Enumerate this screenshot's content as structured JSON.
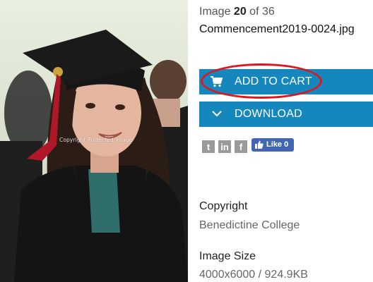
{
  "image_counter": {
    "prefix": "Image",
    "current": "20",
    "separator": "of",
    "total": "36"
  },
  "filename": "Commencement2019-0024.jpg",
  "photo": {
    "watermark": "Copyright Protected Image"
  },
  "buttons": {
    "add_to_cart": {
      "label": "ADD TO CART",
      "icon": "cart-icon"
    },
    "download": {
      "label": "DOWNLOAD",
      "icon": "chevron-down-icon"
    }
  },
  "social": {
    "twitter_glyph": "t",
    "linkedin_glyph": "in",
    "facebook_glyph": "f",
    "fb_like_label": "Like 0"
  },
  "details": {
    "copyright_label": "Copyright",
    "copyright_value": "Benedictine College",
    "size_label": "Image Size",
    "size_value": "4000x6000 / 924.9KB"
  },
  "colors": {
    "button": "#1587bd",
    "highlight": "#e0161f",
    "facebook": "#4267b2",
    "social_gray": "#9a9a9a"
  }
}
